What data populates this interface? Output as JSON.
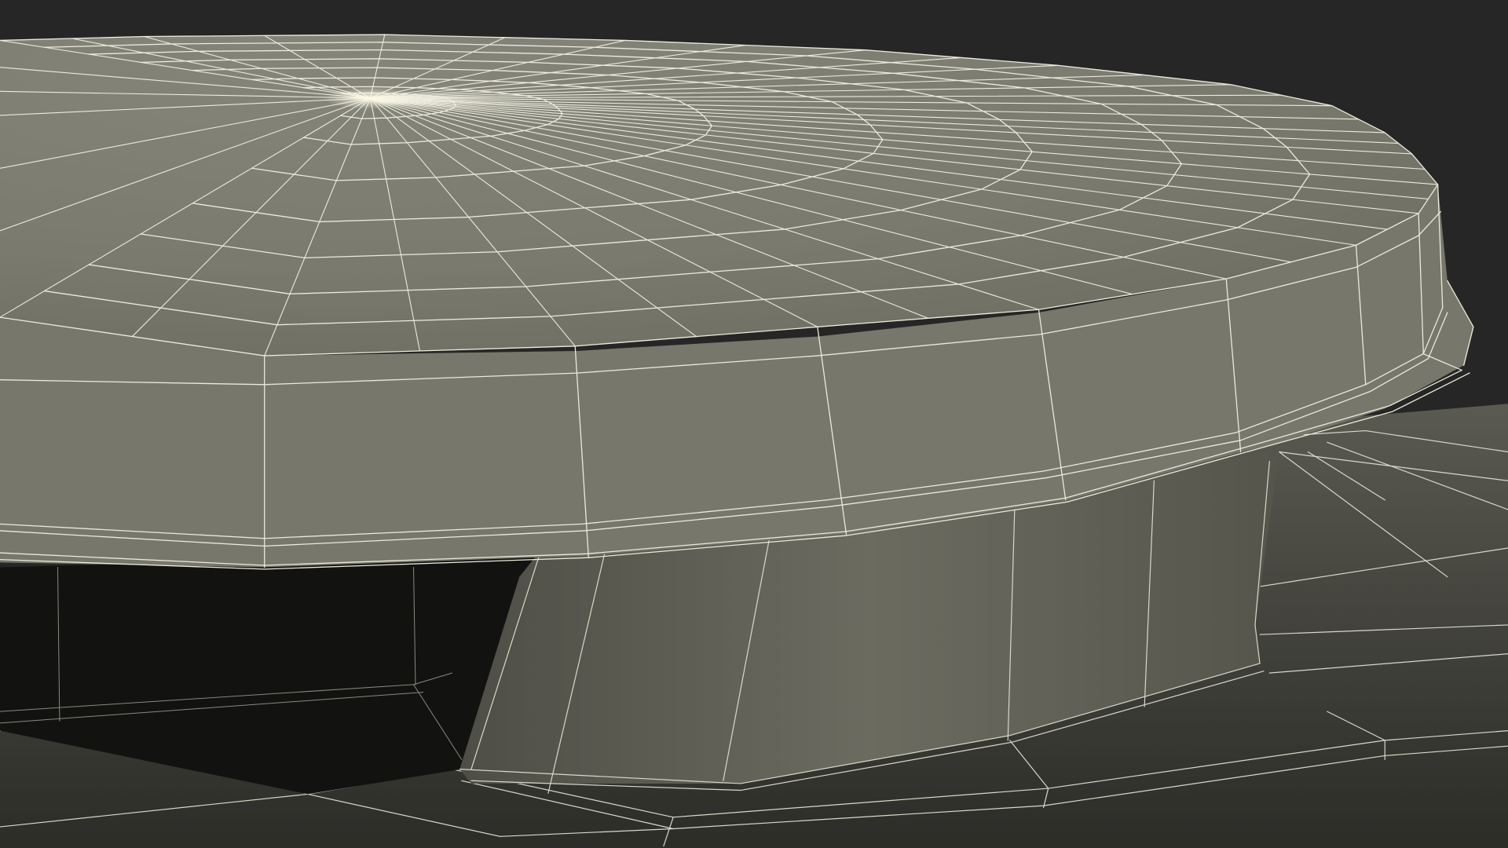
{
  "scene": {
    "subject": "wireframe-render",
    "colors": {
      "background": "#262626",
      "surface_light": "#7b7b6f",
      "surface_mid": "#6f6f64",
      "surface_dark": "#5d5d53",
      "shadow": "#141412",
      "wire": "#e9e8da"
    }
  }
}
